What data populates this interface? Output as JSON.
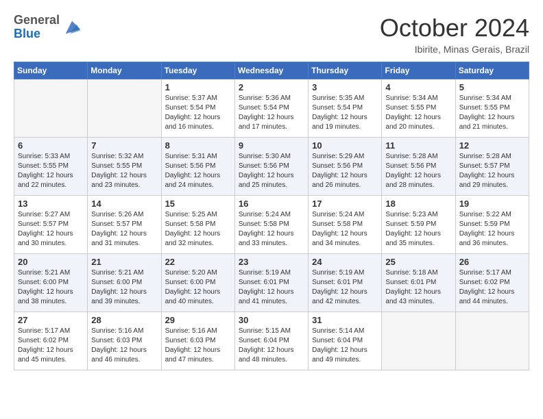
{
  "header": {
    "logo": {
      "general": "General",
      "blue": "Blue"
    },
    "month": "October 2024",
    "location": "Ibirite, Minas Gerais, Brazil"
  },
  "weekdays": [
    "Sunday",
    "Monday",
    "Tuesday",
    "Wednesday",
    "Thursday",
    "Friday",
    "Saturday"
  ],
  "weeks": [
    [
      {
        "day": null
      },
      {
        "day": null
      },
      {
        "day": "1",
        "sunrise": "Sunrise: 5:37 AM",
        "sunset": "Sunset: 5:54 PM",
        "daylight": "Daylight: 12 hours and 16 minutes."
      },
      {
        "day": "2",
        "sunrise": "Sunrise: 5:36 AM",
        "sunset": "Sunset: 5:54 PM",
        "daylight": "Daylight: 12 hours and 17 minutes."
      },
      {
        "day": "3",
        "sunrise": "Sunrise: 5:35 AM",
        "sunset": "Sunset: 5:54 PM",
        "daylight": "Daylight: 12 hours and 19 minutes."
      },
      {
        "day": "4",
        "sunrise": "Sunrise: 5:34 AM",
        "sunset": "Sunset: 5:55 PM",
        "daylight": "Daylight: 12 hours and 20 minutes."
      },
      {
        "day": "5",
        "sunrise": "Sunrise: 5:34 AM",
        "sunset": "Sunset: 5:55 PM",
        "daylight": "Daylight: 12 hours and 21 minutes."
      }
    ],
    [
      {
        "day": "6",
        "sunrise": "Sunrise: 5:33 AM",
        "sunset": "Sunset: 5:55 PM",
        "daylight": "Daylight: 12 hours and 22 minutes."
      },
      {
        "day": "7",
        "sunrise": "Sunrise: 5:32 AM",
        "sunset": "Sunset: 5:55 PM",
        "daylight": "Daylight: 12 hours and 23 minutes."
      },
      {
        "day": "8",
        "sunrise": "Sunrise: 5:31 AM",
        "sunset": "Sunset: 5:56 PM",
        "daylight": "Daylight: 12 hours and 24 minutes."
      },
      {
        "day": "9",
        "sunrise": "Sunrise: 5:30 AM",
        "sunset": "Sunset: 5:56 PM",
        "daylight": "Daylight: 12 hours and 25 minutes."
      },
      {
        "day": "10",
        "sunrise": "Sunrise: 5:29 AM",
        "sunset": "Sunset: 5:56 PM",
        "daylight": "Daylight: 12 hours and 26 minutes."
      },
      {
        "day": "11",
        "sunrise": "Sunrise: 5:28 AM",
        "sunset": "Sunset: 5:56 PM",
        "daylight": "Daylight: 12 hours and 28 minutes."
      },
      {
        "day": "12",
        "sunrise": "Sunrise: 5:28 AM",
        "sunset": "Sunset: 5:57 PM",
        "daylight": "Daylight: 12 hours and 29 minutes."
      }
    ],
    [
      {
        "day": "13",
        "sunrise": "Sunrise: 5:27 AM",
        "sunset": "Sunset: 5:57 PM",
        "daylight": "Daylight: 12 hours and 30 minutes."
      },
      {
        "day": "14",
        "sunrise": "Sunrise: 5:26 AM",
        "sunset": "Sunset: 5:57 PM",
        "daylight": "Daylight: 12 hours and 31 minutes."
      },
      {
        "day": "15",
        "sunrise": "Sunrise: 5:25 AM",
        "sunset": "Sunset: 5:58 PM",
        "daylight": "Daylight: 12 hours and 32 minutes."
      },
      {
        "day": "16",
        "sunrise": "Sunrise: 5:24 AM",
        "sunset": "Sunset: 5:58 PM",
        "daylight": "Daylight: 12 hours and 33 minutes."
      },
      {
        "day": "17",
        "sunrise": "Sunrise: 5:24 AM",
        "sunset": "Sunset: 5:58 PM",
        "daylight": "Daylight: 12 hours and 34 minutes."
      },
      {
        "day": "18",
        "sunrise": "Sunrise: 5:23 AM",
        "sunset": "Sunset: 5:59 PM",
        "daylight": "Daylight: 12 hours and 35 minutes."
      },
      {
        "day": "19",
        "sunrise": "Sunrise: 5:22 AM",
        "sunset": "Sunset: 5:59 PM",
        "daylight": "Daylight: 12 hours and 36 minutes."
      }
    ],
    [
      {
        "day": "20",
        "sunrise": "Sunrise: 5:21 AM",
        "sunset": "Sunset: 6:00 PM",
        "daylight": "Daylight: 12 hours and 38 minutes."
      },
      {
        "day": "21",
        "sunrise": "Sunrise: 5:21 AM",
        "sunset": "Sunset: 6:00 PM",
        "daylight": "Daylight: 12 hours and 39 minutes."
      },
      {
        "day": "22",
        "sunrise": "Sunrise: 5:20 AM",
        "sunset": "Sunset: 6:00 PM",
        "daylight": "Daylight: 12 hours and 40 minutes."
      },
      {
        "day": "23",
        "sunrise": "Sunrise: 5:19 AM",
        "sunset": "Sunset: 6:01 PM",
        "daylight": "Daylight: 12 hours and 41 minutes."
      },
      {
        "day": "24",
        "sunrise": "Sunrise: 5:19 AM",
        "sunset": "Sunset: 6:01 PM",
        "daylight": "Daylight: 12 hours and 42 minutes."
      },
      {
        "day": "25",
        "sunrise": "Sunrise: 5:18 AM",
        "sunset": "Sunset: 6:01 PM",
        "daylight": "Daylight: 12 hours and 43 minutes."
      },
      {
        "day": "26",
        "sunrise": "Sunrise: 5:17 AM",
        "sunset": "Sunset: 6:02 PM",
        "daylight": "Daylight: 12 hours and 44 minutes."
      }
    ],
    [
      {
        "day": "27",
        "sunrise": "Sunrise: 5:17 AM",
        "sunset": "Sunset: 6:02 PM",
        "daylight": "Daylight: 12 hours and 45 minutes."
      },
      {
        "day": "28",
        "sunrise": "Sunrise: 5:16 AM",
        "sunset": "Sunset: 6:03 PM",
        "daylight": "Daylight: 12 hours and 46 minutes."
      },
      {
        "day": "29",
        "sunrise": "Sunrise: 5:16 AM",
        "sunset": "Sunset: 6:03 PM",
        "daylight": "Daylight: 12 hours and 47 minutes."
      },
      {
        "day": "30",
        "sunrise": "Sunrise: 5:15 AM",
        "sunset": "Sunset: 6:04 PM",
        "daylight": "Daylight: 12 hours and 48 minutes."
      },
      {
        "day": "31",
        "sunrise": "Sunrise: 5:14 AM",
        "sunset": "Sunset: 6:04 PM",
        "daylight": "Daylight: 12 hours and 49 minutes."
      },
      {
        "day": null
      },
      {
        "day": null
      }
    ]
  ]
}
